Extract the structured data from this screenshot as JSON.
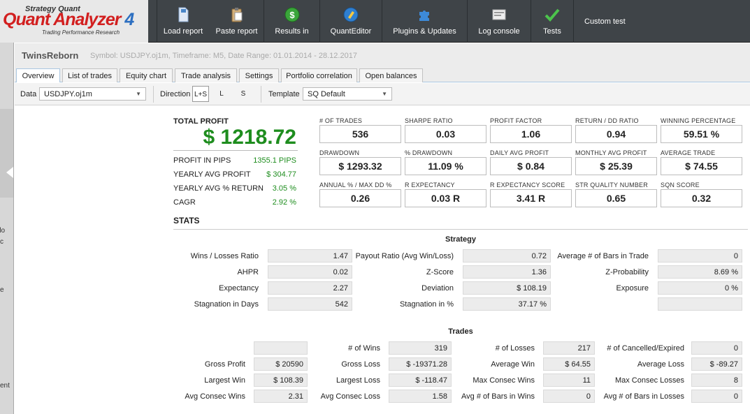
{
  "logo": {
    "top": "Strategy Quant",
    "main": "Quant Analyzer",
    "num": "4",
    "sub": "Trading Performance    Research"
  },
  "toolbar_buttons": [
    {
      "label": "Load report",
      "icon": "document-icon"
    },
    {
      "label": "Paste report",
      "icon": "clipboard-icon"
    },
    {
      "label": "Results in",
      "icon": "dollar-icon"
    },
    {
      "label": "QuantEditor",
      "icon": "editor-icon"
    },
    {
      "label": "Plugins & Updates",
      "icon": "puzzle-icon"
    },
    {
      "label": "Log console",
      "icon": "console-icon"
    },
    {
      "label": "Tests",
      "icon": "checkmark-icon"
    }
  ],
  "custom_test": "Custom test",
  "left_strip": [
    "rlo",
    "c",
    "e",
    "ent"
  ],
  "header": {
    "name": "TwinsReborn",
    "info": "Symbol: USDJPY.oj1m, Timeframe: M5, Date Range: 01.01.2014 - 28.12.2017"
  },
  "tabs": [
    "Overview",
    "List of trades",
    "Equity chart",
    "Trade analysis",
    "Settings",
    "Portfolio correlation",
    "Open balances"
  ],
  "filters": {
    "data_label": "Data",
    "data_value": "USDJPY.oj1m",
    "direction_label": "Direction",
    "directions": [
      "L+S",
      "L",
      "S"
    ],
    "template_label": "Template",
    "template_value": "SQ Default"
  },
  "summary": {
    "total_profit_label": "TOTAL PROFIT",
    "total_profit": "$ 1218.72",
    "rows": [
      {
        "label": "PROFIT IN PIPS",
        "value": "1355.1 PIPS"
      },
      {
        "label": "YEARLY AVG PROFIT",
        "value": "$ 304.77"
      },
      {
        "label": "YEARLY AVG % RETURN",
        "value": "3.05 %"
      },
      {
        "label": "CAGR",
        "value": "2.92 %"
      }
    ]
  },
  "metrics": [
    {
      "label": "# OF TRADES",
      "value": "536"
    },
    {
      "label": "SHARPE RATIO",
      "value": "0.03"
    },
    {
      "label": "PROFIT FACTOR",
      "value": "1.06"
    },
    {
      "label": "RETURN / DD RATIO",
      "value": "0.94"
    },
    {
      "label": "WINNING PERCENTAGE",
      "value": "59.51 %"
    },
    {
      "label": "DRAWDOWN",
      "value": "$ 1293.32"
    },
    {
      "label": "% DRAWDOWN",
      "value": "11.09 %"
    },
    {
      "label": "DAILY AVG PROFIT",
      "value": "$ 0.84"
    },
    {
      "label": "MONTHLY AVG PROFIT",
      "value": "$ 25.39"
    },
    {
      "label": "AVERAGE TRADE",
      "value": "$ 74.55"
    },
    {
      "label": "ANNUAL % / MAX DD %",
      "value": "0.26"
    },
    {
      "label": "R EXPECTANCY",
      "value": "0.03 R"
    },
    {
      "label": "R EXPECTANCY SCORE",
      "value": "3.41 R"
    },
    {
      "label": "STR QUALITY NUMBER",
      "value": "0.65"
    },
    {
      "label": "SQN SCORE",
      "value": "0.32"
    }
  ],
  "stats_title": "STATS",
  "strategy": {
    "title": "Strategy",
    "rows": [
      [
        {
          "label": "Wins / Losses Ratio",
          "value": "1.47"
        },
        {
          "label": "Payout Ratio (Avg Win/Loss)",
          "value": "0.72"
        },
        {
          "label": "Average # of Bars in Trade",
          "value": "0"
        }
      ],
      [
        {
          "label": "AHPR",
          "value": "0.02"
        },
        {
          "label": "Z-Score",
          "value": "1.36"
        },
        {
          "label": "Z-Probability",
          "value": "8.69 %"
        }
      ],
      [
        {
          "label": "Expectancy",
          "value": "2.27"
        },
        {
          "label": "Deviation",
          "value": "$ 108.19"
        },
        {
          "label": "Exposure",
          "value": "0 %"
        }
      ],
      [
        {
          "label": "Stagnation in Days",
          "value": "542"
        },
        {
          "label": "Stagnation in %",
          "value": "37.17 %"
        },
        {
          "label": "",
          "value": ""
        }
      ]
    ]
  },
  "trades": {
    "title": "Trades",
    "rows": [
      [
        {
          "label": "",
          "value": ""
        },
        {
          "label": "# of Wins",
          "value": "319"
        },
        {
          "label": "# of Losses",
          "value": "217"
        },
        {
          "label": "# of Cancelled/Expired",
          "value": "0"
        }
      ],
      [
        {
          "label": "Gross Profit",
          "value": "$ 20590"
        },
        {
          "label": "Gross Loss",
          "value": "$ -19371.28"
        },
        {
          "label": "Average Win",
          "value": "$ 64.55"
        },
        {
          "label": "Average Loss",
          "value": "$ -89.27"
        }
      ],
      [
        {
          "label": "Largest Win",
          "value": "$ 108.39"
        },
        {
          "label": "Largest Loss",
          "value": "$ -118.47"
        },
        {
          "label": "Max Consec Wins",
          "value": "11"
        },
        {
          "label": "Max Consec Losses",
          "value": "8"
        }
      ],
      [
        {
          "label": "Avg Consec Wins",
          "value": "2.31"
        },
        {
          "label": "Avg Consec Loss",
          "value": "1.58"
        },
        {
          "label": "Avg # of Bars in Wins",
          "value": "0"
        },
        {
          "label": "Avg # of Bars in Losses",
          "value": "0"
        }
      ]
    ]
  },
  "colors": {
    "profit_green": "#1e8d1e",
    "toolbar_bg": "#3f4448",
    "logo_red": "#d21f1f"
  }
}
